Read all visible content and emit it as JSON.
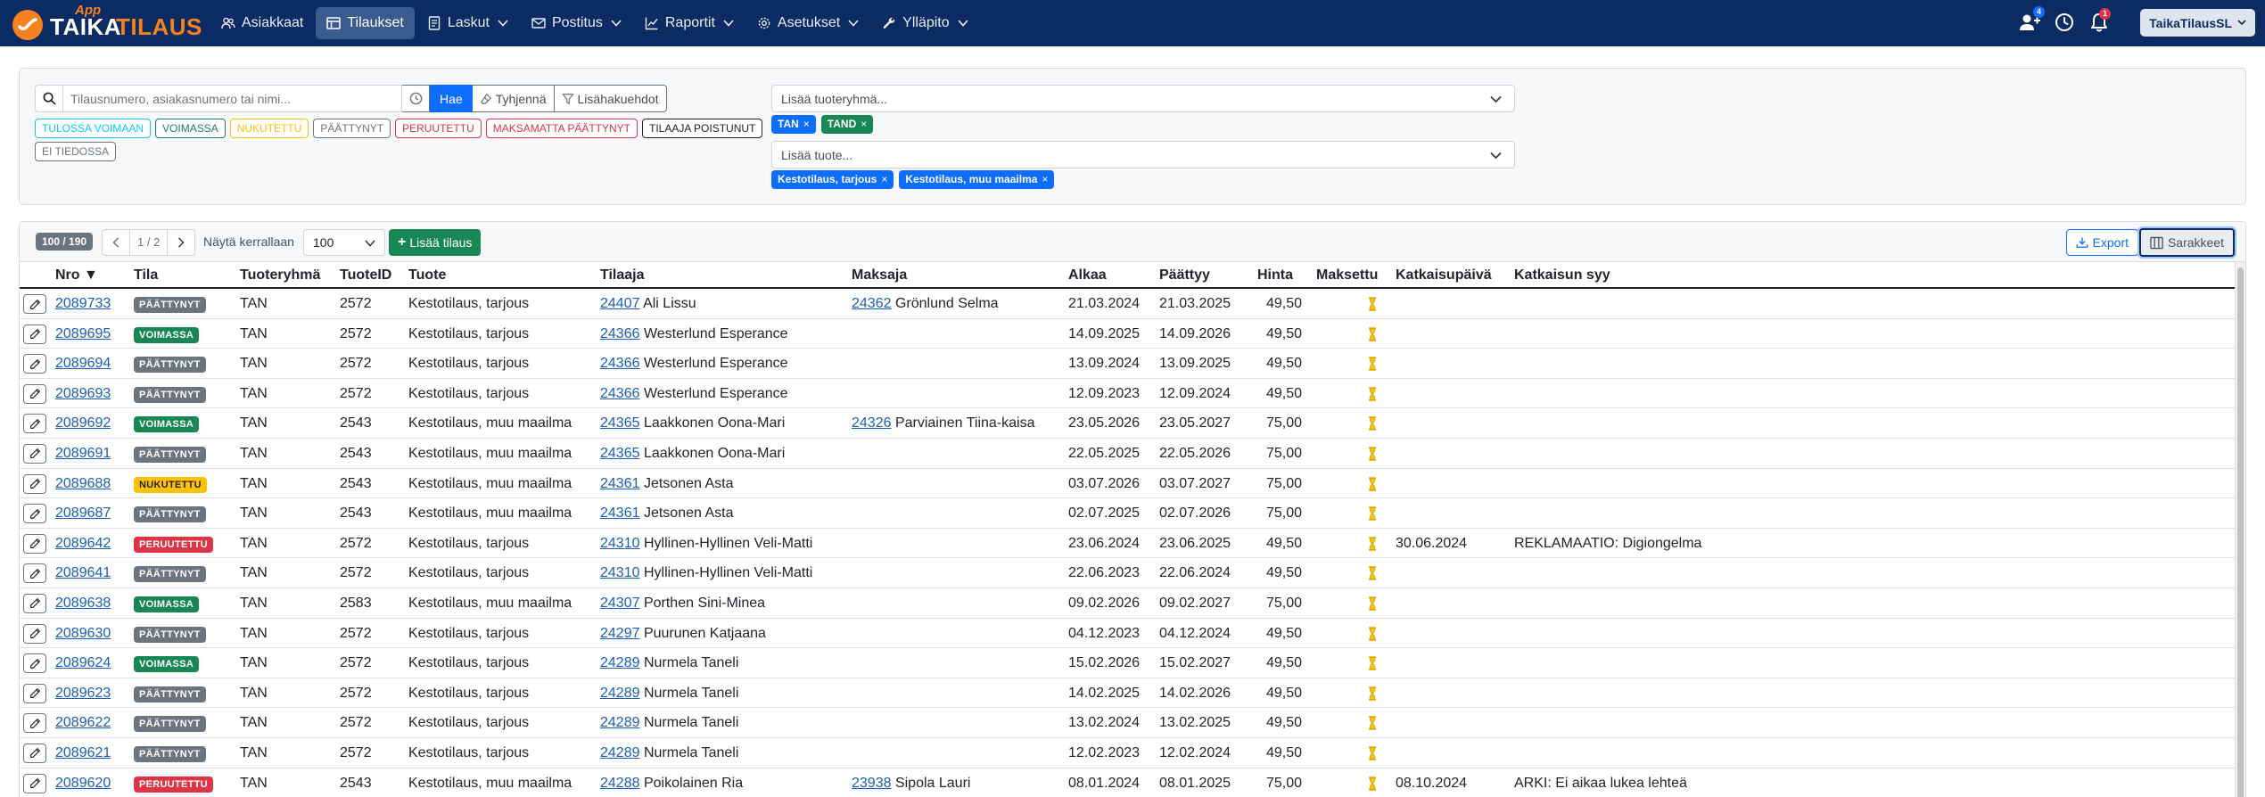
{
  "navbar": {
    "logo_app": "App",
    "logo_taika": "TAIKA",
    "logo_tilaus": "TILAUS",
    "items": [
      {
        "label": "Asiakkaat",
        "icon": "users-icon",
        "active": false,
        "dropdown": false
      },
      {
        "label": "Tilaukset",
        "icon": "table-icon",
        "active": true,
        "dropdown": false
      },
      {
        "label": "Laskut",
        "icon": "invoice-icon",
        "active": false,
        "dropdown": true
      },
      {
        "label": "Postitus",
        "icon": "mail-icon",
        "active": false,
        "dropdown": true
      },
      {
        "label": "Raportit",
        "icon": "chart-icon",
        "active": false,
        "dropdown": true
      },
      {
        "label": "Asetukset",
        "icon": "gear-icon",
        "active": false,
        "dropdown": true
      },
      {
        "label": "Ylläpito",
        "icon": "wrench-icon",
        "active": false,
        "dropdown": true
      }
    ],
    "users_badge": "4",
    "bell_badge": "1",
    "company": "TaikaTilausSL"
  },
  "filters": {
    "search_placeholder": "Tilausnumero, asiakasnumero tai nimi...",
    "search_value": "",
    "search_button": "Hae",
    "clear_button": "Tyhjennä",
    "advanced_button": "Lisähakuehdot",
    "statuses_row1": [
      {
        "label": "TULOSSA VOIMAAN",
        "color": "#0dcaf0"
      },
      {
        "label": "VOIMASSA",
        "color": "#198754"
      },
      {
        "label": "NUKUTETTU",
        "color": "#ffc107"
      },
      {
        "label": "PÄÄTTYNYT",
        "color": "#6c757d"
      },
      {
        "label": "PERUUTETTU",
        "color": "#dc3545"
      },
      {
        "label": "MAKSAMATTA PÄÄTTYNYT",
        "color": "#dc3545"
      },
      {
        "label": "TILAAJA POISTUNUT",
        "color": "#212529"
      }
    ],
    "statuses_row2": [
      {
        "label": "EI TIEDOSSA",
        "color": "#6c757d"
      }
    ],
    "product_group_placeholder": "Lisää tuoteryhmä...",
    "product_group_tags": [
      {
        "label": "TAN",
        "color": "#0d6efd"
      },
      {
        "label": "TAND",
        "color": "#198754"
      }
    ],
    "product_placeholder": "Lisää tuote...",
    "product_tags": [
      {
        "label": "Kestotilaus, tarjous",
        "color": "#0d6efd"
      },
      {
        "label": "Kestotilaus, muu maailma",
        "color": "#0d6efd"
      }
    ]
  },
  "toolbar": {
    "count": "100 / 190",
    "page": "1 / 2",
    "show_label": "Näytä kerrallaan",
    "page_size": "100",
    "add_button": "Lisää tilaus",
    "export_button": "Export",
    "columns_button": "Sarakkeet"
  },
  "columns": [
    "Nro ▼",
    "Tila",
    "Tuoteryhmä",
    "TuoteID",
    "Tuote",
    "Tilaaja",
    "Maksaja",
    "Alkaa",
    "Päättyy",
    "Hinta",
    "Maksettu",
    "Katkaisupäivä",
    "Katkaisun syy"
  ],
  "status_colors": {
    "PÄÄTTYNYT": "#6c757d",
    "VOIMASSA": "#198754",
    "NUKUTETTU": "#ffc107",
    "PERUUTETTU": "#dc3545"
  },
  "rows": [
    {
      "nro": "2089733",
      "tila": "PÄÄTTYNYT",
      "ryhma": "TAN",
      "tuoteid": "2572",
      "tuote": "Kestotilaus, tarjous",
      "tilaaja_id": "24407",
      "tilaaja": "Ali Lissu",
      "maksaja_id": "24362",
      "maksaja": "Grönlund Selma",
      "alkaa": "21.03.2024",
      "paattyy": "21.03.2025",
      "hinta": "49,50",
      "katkaisu": "",
      "syy": ""
    },
    {
      "nro": "2089695",
      "tila": "VOIMASSA",
      "ryhma": "TAN",
      "tuoteid": "2572",
      "tuote": "Kestotilaus, tarjous",
      "tilaaja_id": "24366",
      "tilaaja": "Westerlund Esperance",
      "maksaja_id": "",
      "maksaja": "",
      "alkaa": "14.09.2025",
      "paattyy": "14.09.2026",
      "hinta": "49,50",
      "katkaisu": "",
      "syy": ""
    },
    {
      "nro": "2089694",
      "tila": "PÄÄTTYNYT",
      "ryhma": "TAN",
      "tuoteid": "2572",
      "tuote": "Kestotilaus, tarjous",
      "tilaaja_id": "24366",
      "tilaaja": "Westerlund Esperance",
      "maksaja_id": "",
      "maksaja": "",
      "alkaa": "13.09.2024",
      "paattyy": "13.09.2025",
      "hinta": "49,50",
      "katkaisu": "",
      "syy": ""
    },
    {
      "nro": "2089693",
      "tila": "PÄÄTTYNYT",
      "ryhma": "TAN",
      "tuoteid": "2572",
      "tuote": "Kestotilaus, tarjous",
      "tilaaja_id": "24366",
      "tilaaja": "Westerlund Esperance",
      "maksaja_id": "",
      "maksaja": "",
      "alkaa": "12.09.2023",
      "paattyy": "12.09.2024",
      "hinta": "49,50",
      "katkaisu": "",
      "syy": ""
    },
    {
      "nro": "2089692",
      "tila": "VOIMASSA",
      "ryhma": "TAN",
      "tuoteid": "2543",
      "tuote": "Kestotilaus, muu maailma",
      "tilaaja_id": "24365",
      "tilaaja": "Laakkonen Oona-Mari",
      "maksaja_id": "24326",
      "maksaja": "Parviainen Tiina-kaisa",
      "alkaa": "23.05.2026",
      "paattyy": "23.05.2027",
      "hinta": "75,00",
      "katkaisu": "",
      "syy": ""
    },
    {
      "nro": "2089691",
      "tila": "PÄÄTTYNYT",
      "ryhma": "TAN",
      "tuoteid": "2543",
      "tuote": "Kestotilaus, muu maailma",
      "tilaaja_id": "24365",
      "tilaaja": "Laakkonen Oona-Mari",
      "maksaja_id": "",
      "maksaja": "",
      "alkaa": "22.05.2025",
      "paattyy": "22.05.2026",
      "hinta": "75,00",
      "katkaisu": "",
      "syy": ""
    },
    {
      "nro": "2089688",
      "tila": "NUKUTETTU",
      "ryhma": "TAN",
      "tuoteid": "2543",
      "tuote": "Kestotilaus, muu maailma",
      "tilaaja_id": "24361",
      "tilaaja": "Jetsonen Asta",
      "maksaja_id": "",
      "maksaja": "",
      "alkaa": "03.07.2026",
      "paattyy": "03.07.2027",
      "hinta": "75,00",
      "katkaisu": "",
      "syy": ""
    },
    {
      "nro": "2089687",
      "tila": "PÄÄTTYNYT",
      "ryhma": "TAN",
      "tuoteid": "2543",
      "tuote": "Kestotilaus, muu maailma",
      "tilaaja_id": "24361",
      "tilaaja": "Jetsonen Asta",
      "maksaja_id": "",
      "maksaja": "",
      "alkaa": "02.07.2025",
      "paattyy": "02.07.2026",
      "hinta": "75,00",
      "katkaisu": "",
      "syy": ""
    },
    {
      "nro": "2089642",
      "tila": "PERUUTETTU",
      "ryhma": "TAN",
      "tuoteid": "2572",
      "tuote": "Kestotilaus, tarjous",
      "tilaaja_id": "24310",
      "tilaaja": "Hyllinen-Hyllinen Veli-Matti",
      "maksaja_id": "",
      "maksaja": "",
      "alkaa": "23.06.2024",
      "paattyy": "23.06.2025",
      "hinta": "49,50",
      "katkaisu": "30.06.2024",
      "syy": "REKLAMAATIO: Digiongelma"
    },
    {
      "nro": "2089641",
      "tila": "PÄÄTTYNYT",
      "ryhma": "TAN",
      "tuoteid": "2572",
      "tuote": "Kestotilaus, tarjous",
      "tilaaja_id": "24310",
      "tilaaja": "Hyllinen-Hyllinen Veli-Matti",
      "maksaja_id": "",
      "maksaja": "",
      "alkaa": "22.06.2023",
      "paattyy": "22.06.2024",
      "hinta": "49,50",
      "katkaisu": "",
      "syy": ""
    },
    {
      "nro": "2089638",
      "tila": "VOIMASSA",
      "ryhma": "TAN",
      "tuoteid": "2583",
      "tuote": "Kestotilaus, muu maailma",
      "tilaaja_id": "24307",
      "tilaaja": "Porthen Sini-Minea",
      "maksaja_id": "",
      "maksaja": "",
      "alkaa": "09.02.2026",
      "paattyy": "09.02.2027",
      "hinta": "75,00",
      "katkaisu": "",
      "syy": ""
    },
    {
      "nro": "2089630",
      "tila": "PÄÄTTYNYT",
      "ryhma": "TAN",
      "tuoteid": "2572",
      "tuote": "Kestotilaus, tarjous",
      "tilaaja_id": "24297",
      "tilaaja": "Puurunen Katjaana",
      "maksaja_id": "",
      "maksaja": "",
      "alkaa": "04.12.2023",
      "paattyy": "04.12.2024",
      "hinta": "49,50",
      "katkaisu": "",
      "syy": ""
    },
    {
      "nro": "2089624",
      "tila": "VOIMASSA",
      "ryhma": "TAN",
      "tuoteid": "2572",
      "tuote": "Kestotilaus, tarjous",
      "tilaaja_id": "24289",
      "tilaaja": "Nurmela Taneli",
      "maksaja_id": "",
      "maksaja": "",
      "alkaa": "15.02.2026",
      "paattyy": "15.02.2027",
      "hinta": "49,50",
      "katkaisu": "",
      "syy": ""
    },
    {
      "nro": "2089623",
      "tila": "PÄÄTTYNYT",
      "ryhma": "TAN",
      "tuoteid": "2572",
      "tuote": "Kestotilaus, tarjous",
      "tilaaja_id": "24289",
      "tilaaja": "Nurmela Taneli",
      "maksaja_id": "",
      "maksaja": "",
      "alkaa": "14.02.2025",
      "paattyy": "14.02.2026",
      "hinta": "49,50",
      "katkaisu": "",
      "syy": ""
    },
    {
      "nro": "2089622",
      "tila": "PÄÄTTYNYT",
      "ryhma": "TAN",
      "tuoteid": "2572",
      "tuote": "Kestotilaus, tarjous",
      "tilaaja_id": "24289",
      "tilaaja": "Nurmela Taneli",
      "maksaja_id": "",
      "maksaja": "",
      "alkaa": "13.02.2024",
      "paattyy": "13.02.2025",
      "hinta": "49,50",
      "katkaisu": "",
      "syy": ""
    },
    {
      "nro": "2089621",
      "tila": "PÄÄTTYNYT",
      "ryhma": "TAN",
      "tuoteid": "2572",
      "tuote": "Kestotilaus, tarjous",
      "tilaaja_id": "24289",
      "tilaaja": "Nurmela Taneli",
      "maksaja_id": "",
      "maksaja": "",
      "alkaa": "12.02.2023",
      "paattyy": "12.02.2024",
      "hinta": "49,50",
      "katkaisu": "",
      "syy": ""
    },
    {
      "nro": "2089620",
      "tila": "PERUUTETTU",
      "ryhma": "TAN",
      "tuoteid": "2543",
      "tuote": "Kestotilaus, muu maailma",
      "tilaaja_id": "24288",
      "tilaaja": "Poikolainen Ria",
      "maksaja_id": "23938",
      "maksaja": "Sipola Lauri",
      "alkaa": "08.01.2024",
      "paattyy": "08.01.2025",
      "hinta": "75,00",
      "katkaisu": "08.10.2024",
      "syy": "ARKI: Ei aikaa lukea lehteä"
    }
  ]
}
